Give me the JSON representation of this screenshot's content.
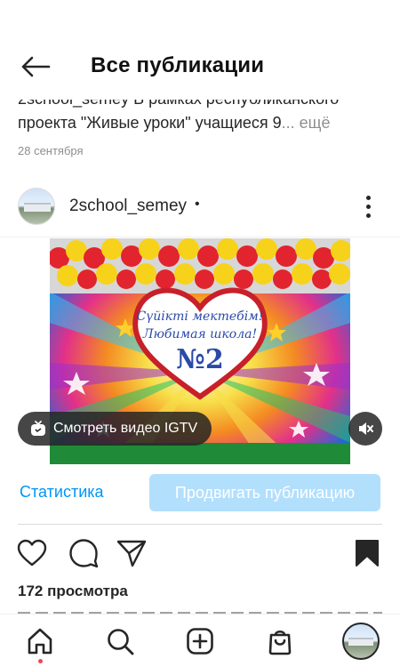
{
  "header": {
    "title": "Все публикации"
  },
  "prev_post": {
    "caption_user": "2school_semey",
    "caption_line1": " В рамках республиканского",
    "caption_line2": "проекта \"Живые уроки\" учащиеся 9",
    "caption_more": "... ещё",
    "date": "28 сентября"
  },
  "post": {
    "username": "2school_semey",
    "username_dot": "•",
    "media_text_line1": "Сүйікті мектебім!",
    "media_text_line2": "Любимая школа!",
    "media_text_number": "№2",
    "igtv_label": "Смотреть видео IGTV",
    "stats_label": "Статистика",
    "promote_label": "Продвигать публикацию",
    "views": "172 просмотра"
  },
  "icons": {
    "back": "arrow-left",
    "options": "three-dots-vertical",
    "igtv": "igtv",
    "mute": "speaker-muted",
    "like": "heart",
    "comment": "speech-bubble",
    "share": "paper-plane",
    "save": "bookmark-filled",
    "nav_home": "home",
    "nav_search": "search",
    "nav_create": "plus-square",
    "nav_shop": "shopping-bag",
    "nav_profile": "profile-avatar"
  },
  "colors": {
    "link_blue": "#0095f6",
    "promote_bg": "#b2dffc",
    "notification_dot": "#ed4956"
  }
}
